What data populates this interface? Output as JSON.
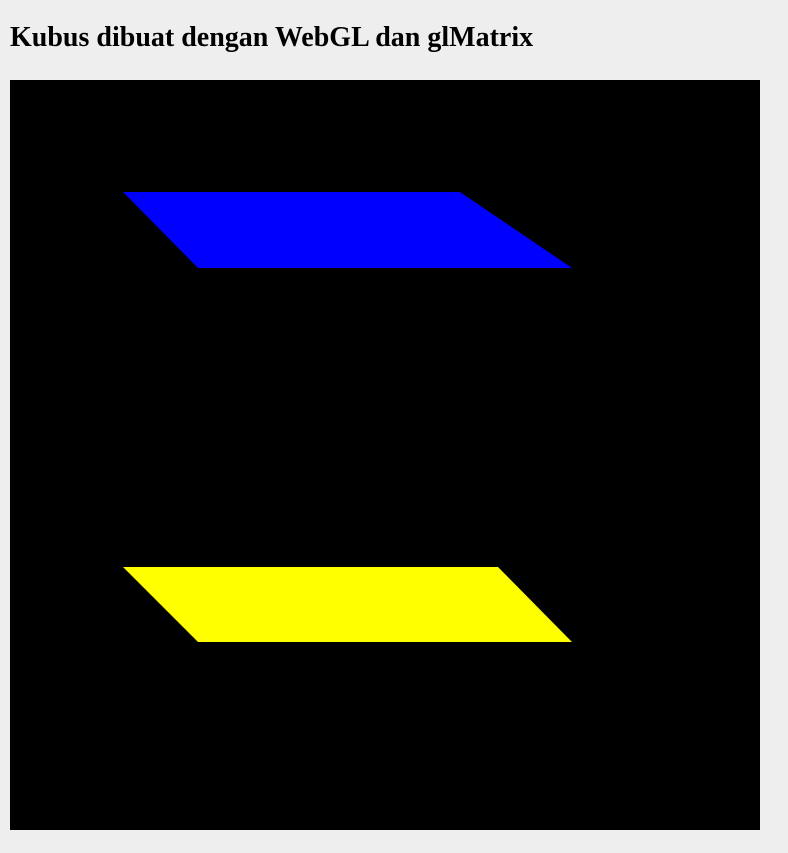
{
  "page": {
    "title": "Kubus dibuat dengan WebGL dan glMatrix"
  },
  "canvas": {
    "background_color": "#000000",
    "faces": [
      {
        "name": "top-face",
        "color": "#0000ff"
      },
      {
        "name": "bottom-face",
        "color": "#ffff00"
      }
    ]
  }
}
